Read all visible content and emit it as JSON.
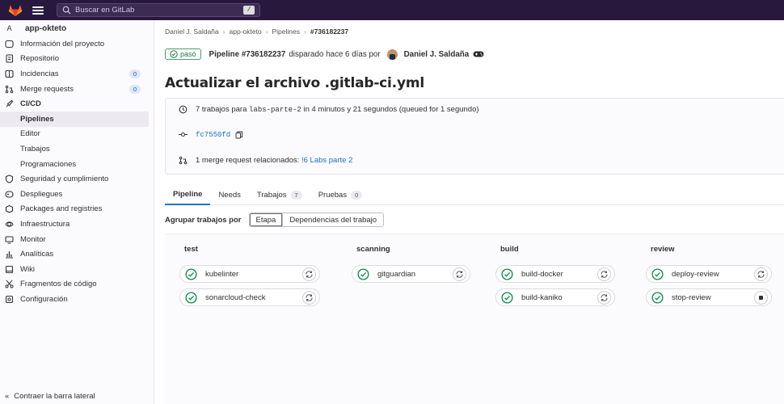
{
  "topbar": {
    "search_placeholder": "Buscar en GitLab",
    "search_shortcut": "/"
  },
  "sidebar": {
    "project_initial": "A",
    "project_name": "app-okteto",
    "items": [
      {
        "label": "Información del proyecto",
        "icon": "info-icon"
      },
      {
        "label": "Repositorio",
        "icon": "doc-icon"
      },
      {
        "label": "Incidencias",
        "icon": "issues-icon",
        "badge": "0"
      },
      {
        "label": "Merge requests",
        "icon": "merge-icon",
        "badge": "0"
      },
      {
        "label": "CI/CD",
        "icon": "rocket-icon"
      }
    ],
    "cicd_sub": [
      "Pipelines",
      "Editor",
      "Trabajos",
      "Programaciones"
    ],
    "items_after": [
      {
        "label": "Seguridad y cumplimiento",
        "icon": "shield-icon"
      },
      {
        "label": "Despliegues",
        "icon": "deploy-icon"
      },
      {
        "label": "Packages and registries",
        "icon": "package-icon"
      },
      {
        "label": "Infraestructura",
        "icon": "cloud-icon"
      },
      {
        "label": "Monitor",
        "icon": "monitor-icon"
      },
      {
        "label": "Analíticas",
        "icon": "chart-icon"
      },
      {
        "label": "Wiki",
        "icon": "book-icon"
      },
      {
        "label": "Fragmentos de código",
        "icon": "scissors-icon"
      },
      {
        "label": "Configuración",
        "icon": "gear-icon"
      }
    ],
    "collapse_label": "Contraer la barra lateral"
  },
  "breadcrumb": {
    "items": [
      "Daniel J. Saldaña",
      "app-okteto",
      "Pipelines"
    ],
    "current": "#736182237"
  },
  "header": {
    "status": "pasó",
    "pipeline_id": "Pipeline #736182237",
    "trigger_text": "disparado hace 6 días por",
    "user": "Daniel J. Saldaña",
    "title": "Actualizar el archivo .gitlab-ci.yml"
  },
  "info": {
    "jobs_prefix": "7 trabajos para",
    "branch": "labs-parte-2",
    "jobs_suffix": "in 4 minutos y 21 segundos (queued for 1 segundo)",
    "commit": "fc7550fd",
    "mr_prefix": "1 merge request relacionados:",
    "mr_link": "!6 Labs parte 2"
  },
  "tabs": [
    {
      "label": "Pipeline"
    },
    {
      "label": "Needs"
    },
    {
      "label": "Trabajos",
      "count": "7"
    },
    {
      "label": "Pruebas",
      "count": "0"
    }
  ],
  "groupby": {
    "label": "Agrupar trabajos por",
    "option_stage": "Etapa",
    "option_deps": "Dependencias del trabajo"
  },
  "stages": [
    {
      "name": "test",
      "jobs": [
        {
          "name": "kubelinter",
          "action": "retry"
        },
        {
          "name": "sonarcloud-check",
          "action": "retry"
        }
      ]
    },
    {
      "name": "scanning",
      "jobs": [
        {
          "name": "gitguardian",
          "action": "retry"
        }
      ]
    },
    {
      "name": "build",
      "jobs": [
        {
          "name": "build-docker",
          "action": "retry"
        },
        {
          "name": "build-kaniko",
          "action": "retry"
        }
      ]
    },
    {
      "name": "review",
      "jobs": [
        {
          "name": "deploy-review",
          "action": "retry"
        },
        {
          "name": "stop-review",
          "action": "stop"
        }
      ]
    }
  ],
  "colors": {
    "topbar": "#28183e",
    "success": "#108548",
    "link": "#1f75cb"
  }
}
